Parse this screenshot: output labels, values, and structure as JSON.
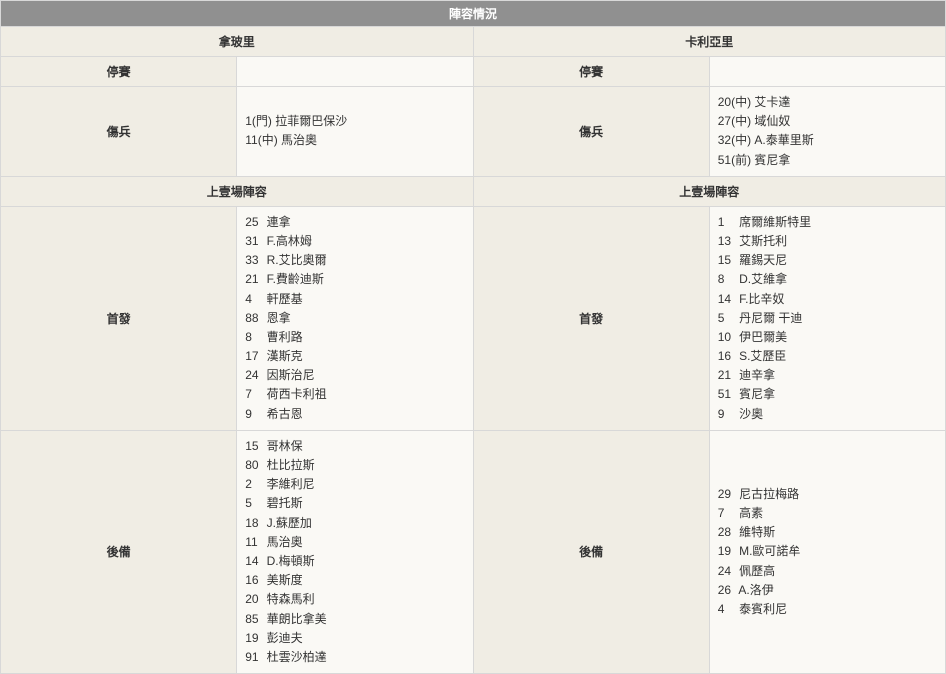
{
  "title": "陣容情況",
  "teams": {
    "left": {
      "name": "拿玻里"
    },
    "right": {
      "name": "卡利亞里"
    }
  },
  "labels": {
    "suspended": "停賽",
    "injured": "傷兵",
    "lastLineup": "上壹場陣容",
    "starting": "首發",
    "subs": "後備"
  },
  "left": {
    "suspended": [],
    "injured": [
      {
        "num": "1",
        "pos": "(門)",
        "name": "拉菲爾巴保沙"
      },
      {
        "num": "11",
        "pos": "(中)",
        "name": "馬治奧"
      }
    ],
    "starting": [
      {
        "num": "25",
        "name": "連拿"
      },
      {
        "num": "31",
        "name": "F.高林姆"
      },
      {
        "num": "33",
        "name": "R.艾比奧爾"
      },
      {
        "num": "21",
        "name": "F.費齡迪斯"
      },
      {
        "num": "4",
        "name": "軒歷基"
      },
      {
        "num": "88",
        "name": "恩拿"
      },
      {
        "num": "8",
        "name": "曹利路"
      },
      {
        "num": "17",
        "name": "漢斯克"
      },
      {
        "num": "24",
        "name": "因斯治尼"
      },
      {
        "num": "7",
        "name": "荷西卡利祖"
      },
      {
        "num": "9",
        "name": "希古恩"
      }
    ],
    "subs": [
      {
        "num": "15",
        "name": "哥林保"
      },
      {
        "num": "80",
        "name": "杜比拉斯"
      },
      {
        "num": "2",
        "name": "李維利尼"
      },
      {
        "num": "5",
        "name": "碧托斯"
      },
      {
        "num": "18",
        "name": "J.蘇歷加"
      },
      {
        "num": "11",
        "name": "馬治奧"
      },
      {
        "num": "14",
        "name": "D.梅頓斯"
      },
      {
        "num": "16",
        "name": "美斯度"
      },
      {
        "num": "20",
        "name": "特森馬利"
      },
      {
        "num": "85",
        "name": "華朗比拿美"
      },
      {
        "num": "19",
        "name": "彭迪夫"
      },
      {
        "num": "91",
        "name": "杜雲沙柏達"
      }
    ]
  },
  "right": {
    "suspended": [],
    "injured": [
      {
        "num": "20",
        "pos": "(中)",
        "name": "艾卡達"
      },
      {
        "num": "27",
        "pos": "(中)",
        "name": "域仙奴"
      },
      {
        "num": "32",
        "pos": "(中)",
        "name": "A.泰華里斯"
      },
      {
        "num": "51",
        "pos": "(前)",
        "name": "賓尼拿"
      }
    ],
    "starting": [
      {
        "num": "1",
        "name": "席爾維斯特里"
      },
      {
        "num": "13",
        "name": "艾斯托利"
      },
      {
        "num": "15",
        "name": "羅錫天尼"
      },
      {
        "num": "8",
        "name": "D.艾維拿"
      },
      {
        "num": "14",
        "name": "F.比辛奴"
      },
      {
        "num": "5",
        "name": "丹尼爾 干迪"
      },
      {
        "num": "10",
        "name": "伊巴爾美"
      },
      {
        "num": "16",
        "name": "S.艾歷臣"
      },
      {
        "num": "21",
        "name": "迪辛拿"
      },
      {
        "num": "51",
        "name": "賓尼拿"
      },
      {
        "num": "9",
        "name": "沙奧"
      }
    ],
    "subs": [
      {
        "num": "29",
        "name": "尼古拉梅路"
      },
      {
        "num": "7",
        "name": "高素"
      },
      {
        "num": "28",
        "name": "維特斯"
      },
      {
        "num": "19",
        "name": "M.歐可諾牟"
      },
      {
        "num": "24",
        "name": "佩歷高"
      },
      {
        "num": "26",
        "name": "A.洛伊"
      },
      {
        "num": "4",
        "name": "泰賓利尼"
      }
    ]
  }
}
